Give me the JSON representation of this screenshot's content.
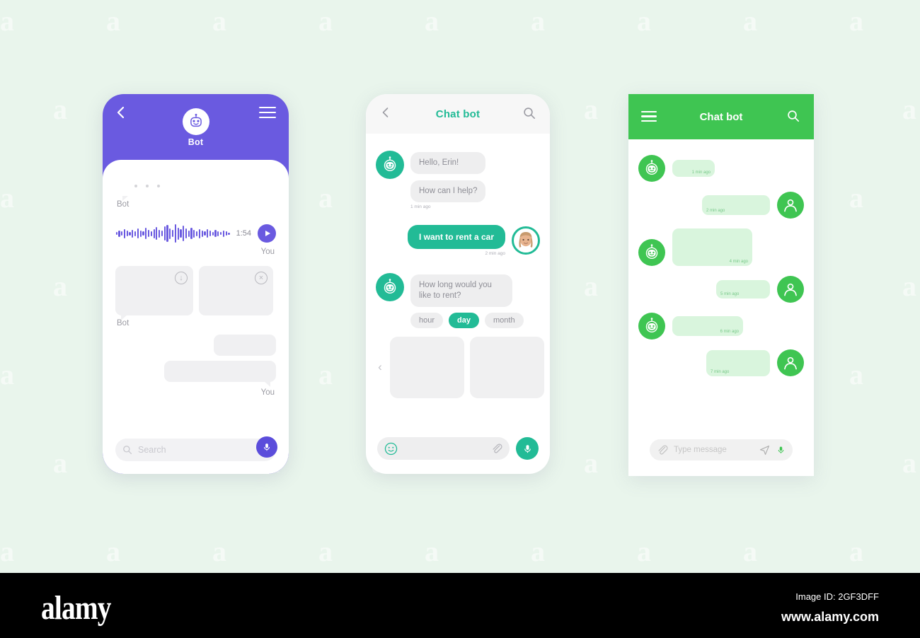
{
  "background_color": "#e9f5ec",
  "watermark": {
    "glyph": "a"
  },
  "phone1": {
    "theme_color": "#6a5ae0",
    "back_icon": "chevron-left-icon",
    "menu_icon": "hamburger-menu-icon",
    "avatar_icon": "bot-avatar-icon",
    "title": "Bot",
    "typing_indicator_label": "Bot",
    "voice": {
      "duration": "1:54",
      "play_icon": "play-icon",
      "sender_label": "You",
      "waveform": [
        4,
        9,
        6,
        13,
        8,
        5,
        11,
        7,
        14,
        9,
        6,
        16,
        10,
        7,
        13,
        18,
        11,
        8,
        20,
        24,
        15,
        10,
        26,
        17,
        12,
        22,
        14,
        9,
        16,
        11,
        7,
        13,
        9,
        6,
        12,
        8,
        5,
        10,
        7,
        4,
        9,
        6,
        3
      ]
    },
    "cards": {
      "download_icon": "download-circle-icon",
      "close_icon": "close-circle-icon",
      "sender_label": "Bot"
    },
    "outgoing_label": "You",
    "search": {
      "icon": "search-icon",
      "placeholder": "Search",
      "mic_icon": "microphone-icon"
    }
  },
  "phone2": {
    "theme_color": "#22bb96",
    "title": "Chat bot",
    "back_icon": "chevron-left-icon",
    "search_icon": "search-icon",
    "bot_avatar_icon": "bot-avatar-icon",
    "user_avatar_icon": "user-photo-avatar",
    "messages": [
      {
        "from": "bot",
        "text": "Hello, Erin!",
        "time": ""
      },
      {
        "from": "bot",
        "text": "How can I help?",
        "time": "1 min ago"
      },
      {
        "from": "user",
        "text": "I want to rent a car",
        "time": "2 min ago"
      },
      {
        "from": "bot",
        "text": "How long would you like to rent?",
        "time": ""
      }
    ],
    "chips": [
      {
        "label": "hour",
        "selected": false
      },
      {
        "label": "day",
        "selected": true
      },
      {
        "label": "month",
        "selected": false
      }
    ],
    "carousel": {
      "prev_icon": "chevron-left-icon",
      "next_icon": "chevron-right-icon",
      "card_count": 2
    },
    "input": {
      "emoji_icon": "emoji-smiley-icon",
      "attach_icon": "paperclip-icon",
      "mic_icon": "microphone-icon",
      "placeholder": ""
    }
  },
  "phone3": {
    "theme_color": "#3fc552",
    "bubble_color": "#d9f5dd",
    "title": "Chat bot",
    "menu_icon": "hamburger-menu-icon",
    "search_icon": "search-icon",
    "bot_avatar_icon": "bot-avatar-icon",
    "user_avatar_icon": "user-silhouette-icon",
    "messages": [
      {
        "from": "bot",
        "time": "1 min ago"
      },
      {
        "from": "user",
        "time": "2 min ago"
      },
      {
        "from": "bot",
        "time": "4 min ago"
      },
      {
        "from": "user",
        "time": "5 min ago"
      },
      {
        "from": "bot",
        "time": "6 min ago"
      },
      {
        "from": "user",
        "time": "7 min ago"
      }
    ],
    "input": {
      "attach_icon": "paperclip-icon",
      "placeholder": "Type message",
      "send_icon": "send-icon",
      "mic_icon": "microphone-icon"
    }
  },
  "footer": {
    "logo": "alamy",
    "image_id": "Image ID: 2GF3DFF",
    "website": "www.alamy.com"
  }
}
